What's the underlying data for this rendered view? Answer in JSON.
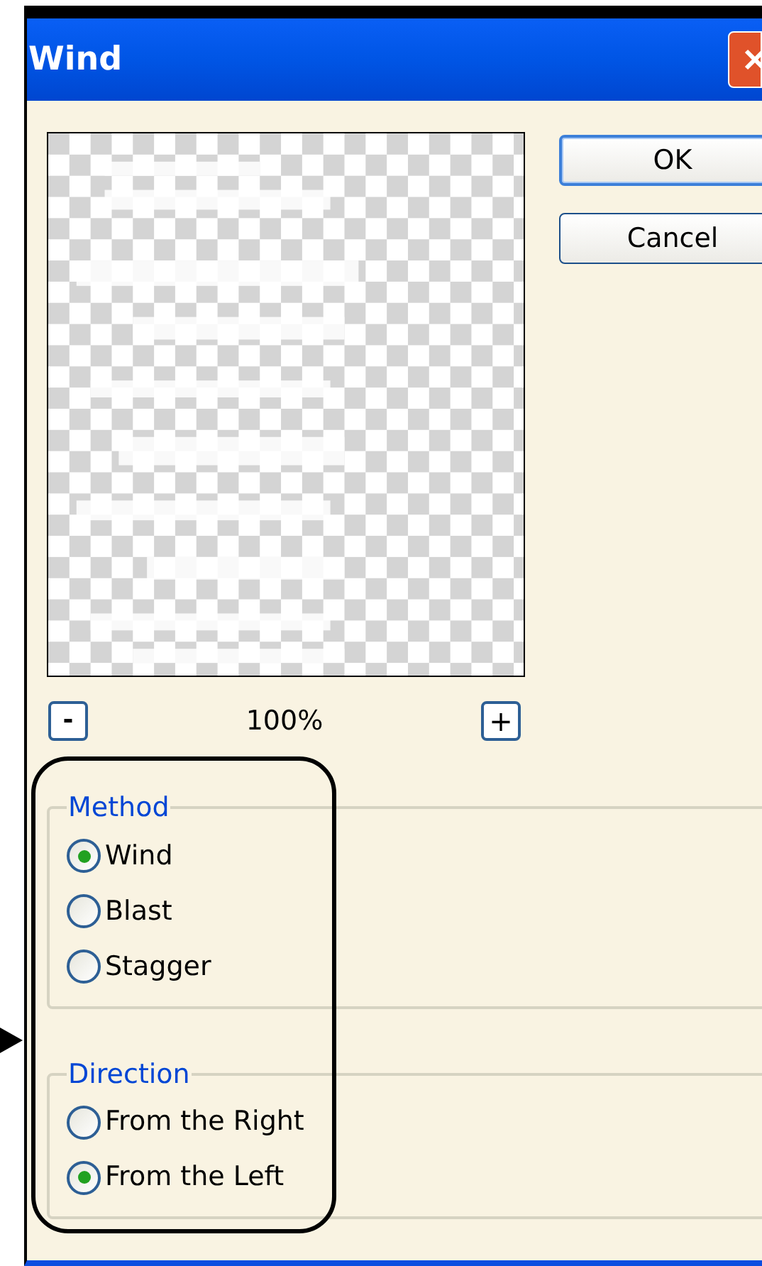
{
  "window": {
    "title": "Wind"
  },
  "buttons": [
    {
      "label": "OK",
      "default": true
    },
    {
      "label": "Cancel",
      "default": false
    }
  ],
  "zoom": {
    "minus": "-",
    "value": "100%",
    "plus": "+"
  },
  "groups": [
    {
      "title": "Method",
      "options": [
        {
          "label": "Wind",
          "selected": true
        },
        {
          "label": "Blast",
          "selected": false
        },
        {
          "label": "Stagger",
          "selected": false
        }
      ]
    },
    {
      "title": "Direction",
      "options": [
        {
          "label": "From the Right",
          "selected": false
        },
        {
          "label": "From the Left",
          "selected": true
        }
      ]
    }
  ]
}
